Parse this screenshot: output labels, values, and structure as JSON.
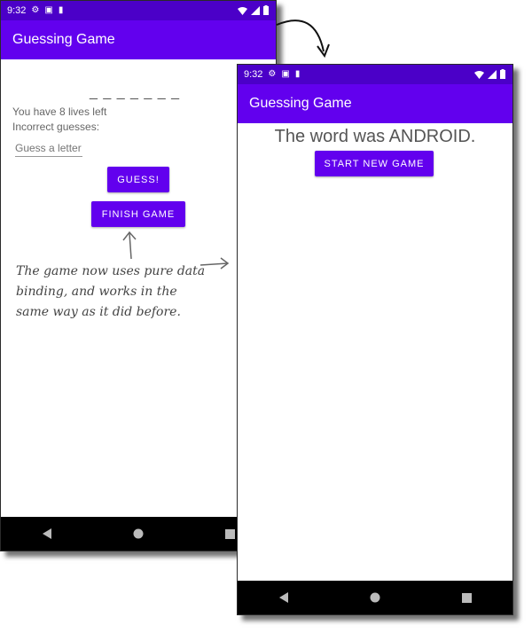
{
  "left_phone": {
    "status_time": "9:32",
    "app_title": "Guessing Game",
    "secret_word": "_ _ _ _ _ _ _",
    "lives_text": "You have 8 lives left",
    "incorrect_label": "Incorrect guesses:",
    "guess_placeholder": "Guess a letter",
    "guess_button": "GUESS!",
    "finish_button": "FINISH GAME"
  },
  "right_phone": {
    "status_time": "9:32",
    "app_title": "Guessing Game",
    "result_text": "The word was ANDROID.",
    "new_game_button": "START NEW GAME"
  },
  "annotation": "The game now uses pure data binding, and works in the same way as it did before.",
  "colors": {
    "accent": "#6200ee",
    "status_bar": "#4b00c8",
    "nav_bar": "#000000"
  },
  "icons": [
    "gear-icon",
    "sim-icon",
    "sd-card-icon",
    "wifi-icon",
    "signal-icon",
    "battery-icon",
    "back-icon",
    "home-icon",
    "recents-icon"
  ]
}
